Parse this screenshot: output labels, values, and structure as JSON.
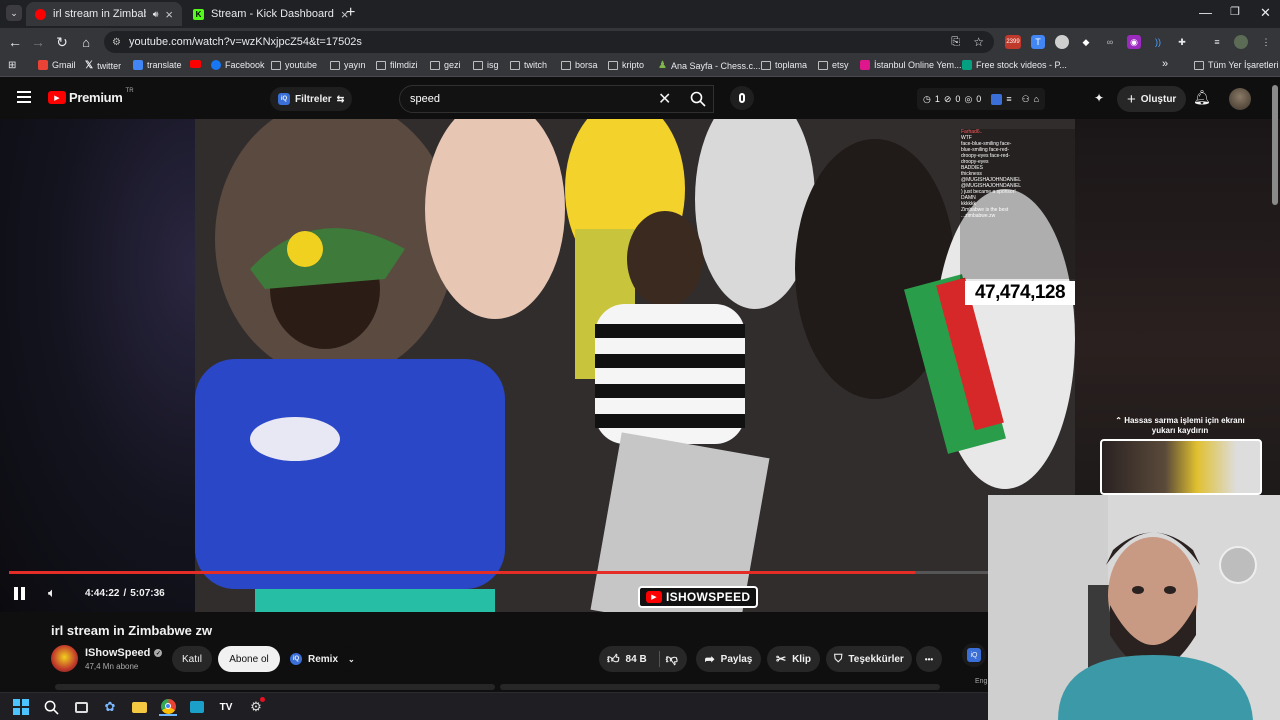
{
  "browser": {
    "tabs": [
      {
        "title": "irl stream in Zimbabwe zw",
        "active": true
      },
      {
        "title": "Stream - Kick Dashboard",
        "active": false
      }
    ],
    "new_tab_symbol": "+",
    "url": "youtube.com/watch?v=wzKNxjpcZ54&t=17502s",
    "ext_badge": "2399",
    "bookmarks": [
      {
        "label": "Gmail"
      },
      {
        "label": "twitter"
      },
      {
        "label": "translate"
      },
      {
        "label": ""
      },
      {
        "label": "Facebook"
      },
      {
        "label": "youtube"
      },
      {
        "label": "yayın"
      },
      {
        "label": "filmdizi"
      },
      {
        "label": "gezi"
      },
      {
        "label": "isg"
      },
      {
        "label": "twitch"
      },
      {
        "label": "borsa"
      },
      {
        "label": "kripto"
      },
      {
        "label": "Ana Sayfa - Chess.c..."
      },
      {
        "label": "toplama"
      },
      {
        "label": "etsy"
      },
      {
        "label": "İstanbul Online Yem..."
      },
      {
        "label": "Free stock videos - P..."
      }
    ],
    "all_bookmarks": "Tüm Yer İşaretleri",
    "bookmarks_overflow": "»"
  },
  "youtube": {
    "logo_text": "Premium",
    "logo_region": "TR",
    "filters_label": "Filtreler",
    "search_value": "speed",
    "stats": {
      "a": "1",
      "b": "0",
      "c": "0"
    },
    "create_label": "Oluştur"
  },
  "video": {
    "overlay_count": "47,474,128",
    "watermark": "ISHOWSPEED",
    "time_current": "4:44:22",
    "time_separator": "/",
    "time_total": "5:07:36",
    "progress": 0.925,
    "chat": [
      "Farhad6..",
      "WTF",
      "face-blue-smiling face-",
      "blue-smiling face-red-",
      "droopy-eyes face-red-",
      "droopy-eyes",
      "BADDIES",
      "thickness",
      "@MUGISHAJOHNDANIEL",
      "@MUGISHAJOHNDANIEL",
      ") just became a sponsor!",
      "DAMN",
      "kkkkkk",
      "Zimbabwe is the best",
      "...zimbabwe.zw"
    ]
  },
  "scroll_hint": "Hassas sarma işlemi için ekranı yukarı kaydırın",
  "below": {
    "video_title": "irl stream in Zimbabwe zw",
    "channel_name": "IShowSpeed",
    "subscribers": "47,4 Mn abone",
    "join_label": "Katıl",
    "subscribe_label": "Abone ol",
    "remix_label": "Remix",
    "likes": "84 B",
    "share_label": "Paylaş",
    "clip_label": "Klip",
    "thanks_label": "Teşekkürler",
    "more_label": "•••",
    "eng_label": "Eng"
  },
  "colors": {
    "youtube_red": "#ff0000",
    "progress_red": "#e52d27",
    "chrome_dark": "#202124",
    "chrome_toolbar": "#35363a"
  }
}
